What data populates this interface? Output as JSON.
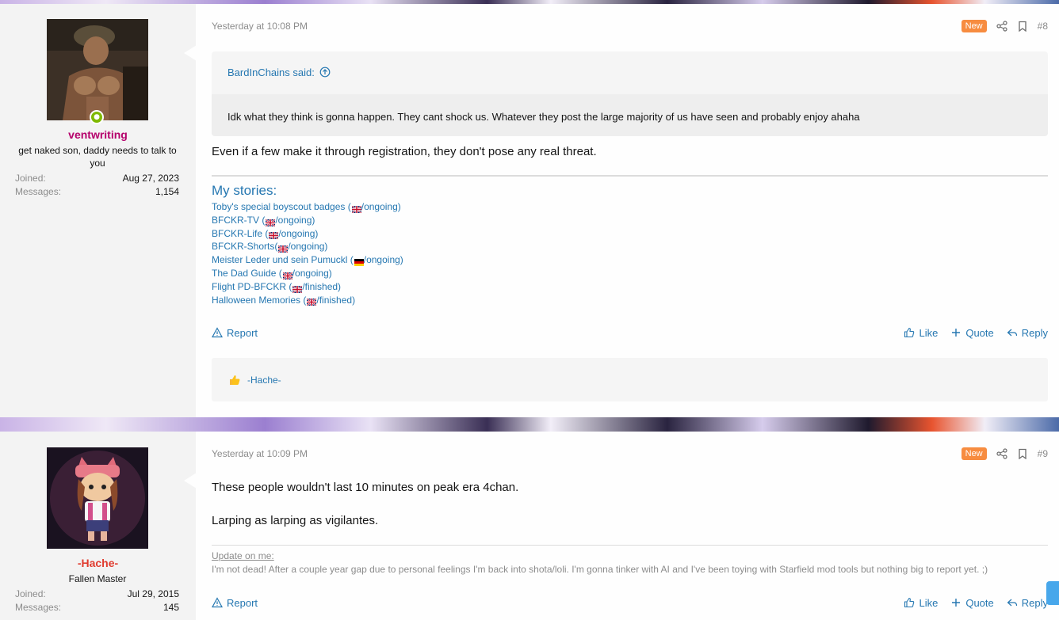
{
  "colors": {
    "accent": "#2577b1",
    "new_badge": "#f78c40",
    "online": "#7fb900",
    "username1": "#b5006b",
    "username2": "#e03c2f",
    "muted": "#8c8c8c"
  },
  "posts": [
    {
      "date": "Yesterday at 10:08 PM",
      "new_label": "New",
      "number": "#8",
      "author": {
        "name": "ventwriting",
        "title": "get naked son, daddy needs to talk to you",
        "joined_label": "Joined:",
        "joined": "Aug 27, 2023",
        "messages_label": "Messages:",
        "messages": "1,154"
      },
      "quote": {
        "author": "BardInChains said:",
        "text": "Idk what they think is gonna happen. They cant shock us. Whatever they post the large majority of us have seen and probably enjoy ahaha"
      },
      "message": "Even if a few make it through registration, they don't pose any real threat.",
      "signature": {
        "title": "My stories:",
        "stories": [
          {
            "pre": "Toby's special boyscout badges (",
            "flag": "uk",
            "post": "/ongoing)"
          },
          {
            "pre": "BFCKR-TV (",
            "flag": "uk",
            "post": "/ongoing)"
          },
          {
            "pre": "BFCKR-Life (",
            "flag": "uk",
            "post": "/ongoing)"
          },
          {
            "pre": "BFCKR-Shorts(",
            "flag": "uk",
            "post": "/ongoing)"
          },
          {
            "pre": "Meister Leder und sein Pumuckl (",
            "flag": "de",
            "post": "/ongoing)"
          },
          {
            "pre": "The Dad Guide (",
            "flag": "uk",
            "post": "/ongoing)"
          },
          {
            "pre": "Flight PD-BFCKR (",
            "flag": "uk",
            "post": "/finished)"
          },
          {
            "pre": "Halloween Memories (",
            "flag": "uk",
            "post": "/finished)"
          }
        ]
      },
      "actions": {
        "report": "Report",
        "like": "Like",
        "quote": "Quote",
        "reply": "Reply"
      },
      "reaction_user": "-Hache-"
    },
    {
      "date": "Yesterday at 10:09 PM",
      "new_label": "New",
      "number": "#9",
      "author": {
        "name": "-Hache-",
        "title": "Fallen Master",
        "joined_label": "Joined:",
        "joined": "Jul 29, 2015",
        "messages_label": "Messages:",
        "messages": "145"
      },
      "message_lines": [
        "These people wouldn't last 10 minutes on peak era 4chan.",
        "Larping as larping as vigilantes."
      ],
      "signature": {
        "label": "Update on me:",
        "text": "I'm not dead! After a couple year gap due to personal feelings I'm back into shota/loli. I'm gonna tinker with AI and I've been toying with Starfield mod tools but nothing big to report yet. ;)"
      },
      "actions": {
        "report": "Report",
        "like": "Like",
        "quote": "Quote",
        "reply": "Reply"
      }
    }
  ]
}
